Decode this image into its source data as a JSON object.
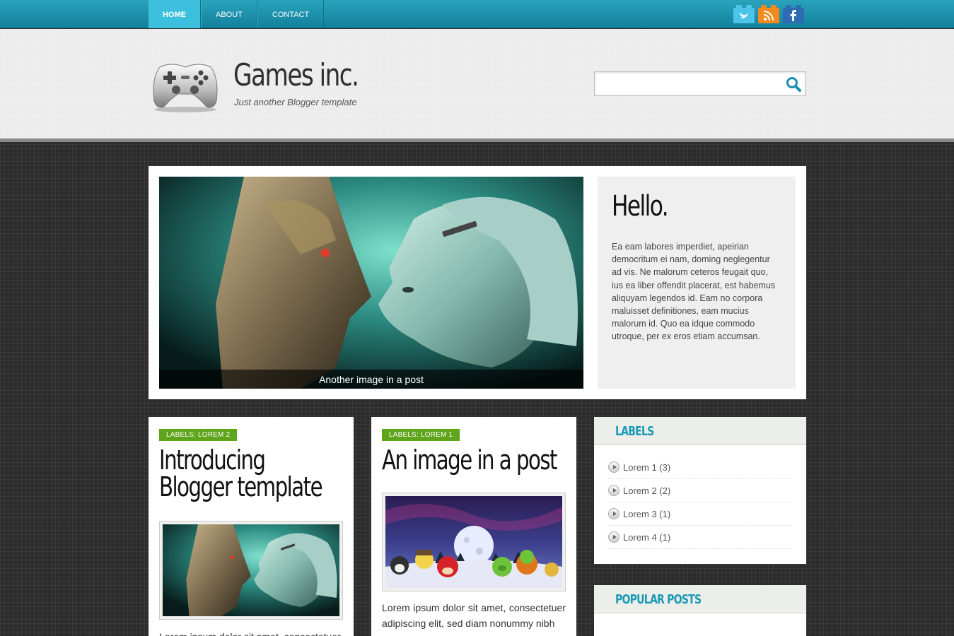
{
  "nav": {
    "items": [
      {
        "label": "HOME",
        "active": true
      },
      {
        "label": "ABOUT",
        "active": false
      },
      {
        "label": "CONTACT",
        "active": false
      }
    ]
  },
  "social": [
    {
      "icon": "twitter-icon",
      "color": "#4cc3e8"
    },
    {
      "icon": "rss-icon",
      "color": "#f28a1e"
    },
    {
      "icon": "facebook-icon",
      "color": "#2d6cb3"
    }
  ],
  "header": {
    "title": "Games inc.",
    "tagline": "Just another Blogger template",
    "search_value": ""
  },
  "featured": {
    "caption": "Another image in a post",
    "hello_title": "Hello.",
    "hello_text": "Ea eam labores imperdiet, apeirian democritum ei nam, doming neglegentur ad vis. Ne malorum ceteros feugait quo, ius ea liber offendit placerat, est habemus aliquyam legendos id. Eam no corpora maluisset definitiones, eam mucius malorum id. Quo ea idque commodo utroque, per ex eros etiam accumsan."
  },
  "posts": [
    {
      "label": "LABELS: LOREM 2",
      "title": "Introducing Blogger template",
      "excerpt": "Lorem ipsum dolor sit amet, consectetuer"
    },
    {
      "label": "LABELS: LOREM 1",
      "title": "An image in a post",
      "excerpt": "Lorem ipsum dolor sit amet, consectetuer adipiscing elit, sed diam nonummy nibh"
    }
  ],
  "sidebar": {
    "labels_title": "LABELS",
    "labels": [
      {
        "text": "Lorem 1 (3)"
      },
      {
        "text": "Lorem 2 (2)"
      },
      {
        "text": "Lorem 3 (1)"
      },
      {
        "text": "Lorem 4 (1)"
      }
    ],
    "popular_title": "POPULAR POSTS"
  },
  "colors": {
    "nav": "#1b93ad",
    "nav_active": "#3cc0de",
    "label_green": "#5ea51b",
    "widget_title": "#1a9ab5"
  }
}
